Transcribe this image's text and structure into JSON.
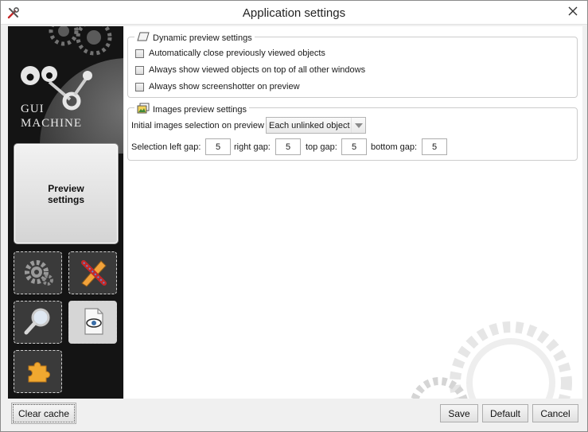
{
  "window": {
    "title": "Application settings"
  },
  "sidebar": {
    "logo_line1": "GUI",
    "logo_line2": "MACHINE",
    "active_tile_label": "Preview\nsettings",
    "tiles": [
      {
        "name": "general-settings",
        "icon": "gears-icon"
      },
      {
        "name": "tools-settings",
        "icon": "pencil-ruler-icon"
      },
      {
        "name": "search-settings",
        "icon": "magnifier-icon"
      },
      {
        "name": "viewer-settings",
        "icon": "eye-document-icon"
      },
      {
        "name": "plugins-settings",
        "icon": "puzzle-icon"
      }
    ]
  },
  "dynamic_preview": {
    "title": "Dynamic preview settings",
    "options": [
      {
        "label": "Automatically close previously viewed objects",
        "checked": false
      },
      {
        "label": "Always show viewed objects on top of all other windows",
        "checked": false
      },
      {
        "label": "Always show screenshotter on preview",
        "checked": false
      }
    ]
  },
  "images_preview": {
    "title": "Images preview settings",
    "initial_selection_label": "Initial images selection on preview",
    "initial_selection_value": "Each unlinked object",
    "left_gap_label": "Selection left gap:",
    "left_gap_value": "5",
    "right_gap_label": "right gap:",
    "right_gap_value": "5",
    "top_gap_label": "top gap:",
    "top_gap_value": "5",
    "bottom_gap_label": "bottom gap:",
    "bottom_gap_value": "5"
  },
  "footer": {
    "clear_cache_label": "Clear cache",
    "save_label": "Save",
    "default_label": "Default",
    "cancel_label": "Cancel"
  },
  "colors": {
    "sidebar_bg": "#141414",
    "content_bg": "#ffffff",
    "window_bg": "#f0f0f0"
  }
}
